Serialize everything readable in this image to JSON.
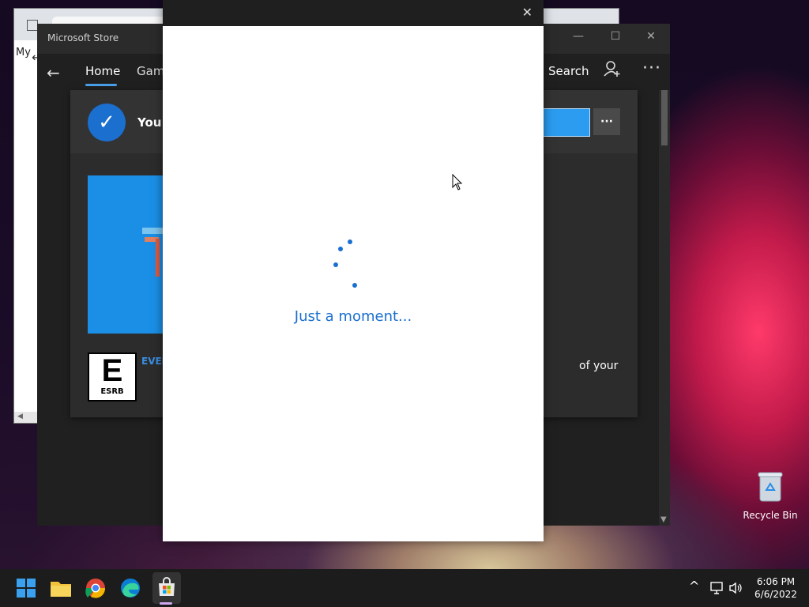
{
  "store_window": {
    "title": "Microsoft Store",
    "nav": {
      "home": "Home",
      "gaming": "Gami",
      "search": "Search"
    },
    "card": {
      "status_text": "You c",
      "more_label": "···",
      "esrb_letter": "E",
      "esrb_label": "ESRB",
      "rating_text": "EVER",
      "description_fragment": "of your"
    }
  },
  "browser_back": {
    "partial_text": "My"
  },
  "modal": {
    "loading_text": "Just a moment..."
  },
  "desktop": {
    "recycle_bin_label": "Recycle Bin"
  },
  "taskbar": {
    "time": "6:06 PM",
    "date": "6/6/2022",
    "apps": [
      "Start",
      "File Explorer",
      "Google Chrome",
      "Microsoft Edge",
      "Microsoft Store"
    ]
  },
  "colors": {
    "accent": "#1a6fcf",
    "store_bg": "#202020",
    "taskbar_bg": "#1c1c1c"
  }
}
